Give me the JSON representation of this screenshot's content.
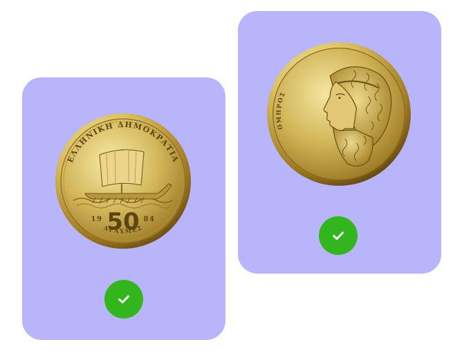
{
  "cards": [
    {
      "coin": {
        "side": "reverse",
        "header_text": "ΕΛΛΗΝΙΚΗ ΔΗΜΟΚΡΑΤΙΑ",
        "year_left": "19",
        "year_right": "84",
        "denomination": "50",
        "currency": "ΔΡΑΧΜΕΣ"
      },
      "status": {
        "icon": "checkmark-icon",
        "state": "selected"
      }
    },
    {
      "coin": {
        "side": "obverse",
        "portrait_label": "ΟΜΗΡΟΣ"
      },
      "status": {
        "icon": "checkmark-icon",
        "state": "selected"
      }
    }
  ],
  "colors": {
    "card_background": "#b9b5fb",
    "check_green": "#33b51e",
    "gold_light": "#f1e39a",
    "gold_dark": "#8c6a1c"
  }
}
